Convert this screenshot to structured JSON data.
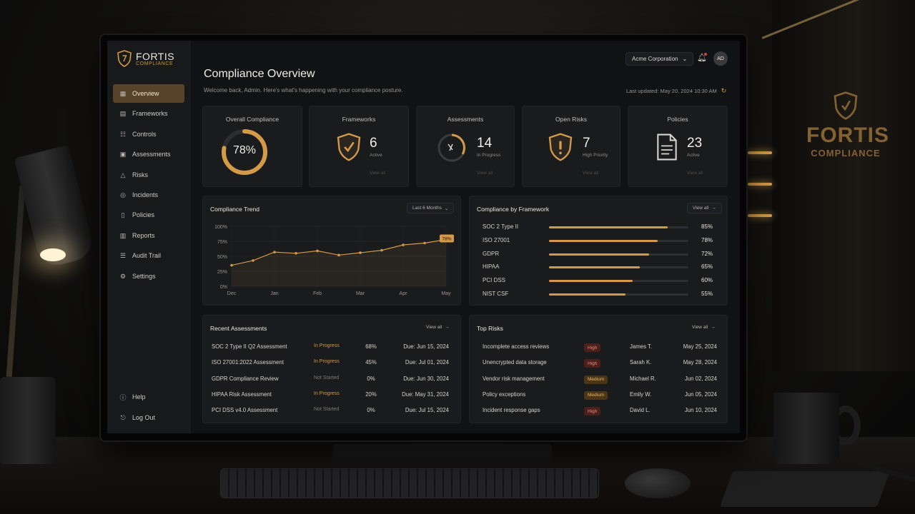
{
  "brand": {
    "name": "FORTIS",
    "tagline": "COMPLIANCE"
  },
  "wall_logo": {
    "name": "FORTIS",
    "tagline": "COMPLIANCE"
  },
  "sidebar": {
    "items": [
      {
        "label": "Overview",
        "icon": "grid-icon",
        "active": true
      },
      {
        "label": "Frameworks",
        "icon": "layers-icon"
      },
      {
        "label": "Controls",
        "icon": "sliders-icon"
      },
      {
        "label": "Assessments",
        "icon": "clipboard-icon"
      },
      {
        "label": "Risks",
        "icon": "warning-icon"
      },
      {
        "label": "Incidents",
        "icon": "alert-icon"
      },
      {
        "label": "Policies",
        "icon": "document-icon"
      },
      {
        "label": "Reports",
        "icon": "chart-icon"
      },
      {
        "label": "Audit Trail",
        "icon": "list-icon"
      },
      {
        "label": "Settings",
        "icon": "gear-icon"
      }
    ],
    "bottom": [
      {
        "label": "Help",
        "icon": "help-icon"
      },
      {
        "label": "Log Out",
        "icon": "logout-icon"
      }
    ]
  },
  "header": {
    "org": "Acme Corporation",
    "avatar": "AD",
    "title": "Compliance Overview",
    "subtitle": "Welcome back, Admin. Here's what's happening with your compliance posture.",
    "updated": "Last updated: May 20, 2024 10:30 AM"
  },
  "stats": [
    {
      "title": "Overall Compliance",
      "value": "78%",
      "progress": 0.78
    },
    {
      "title": "Frameworks",
      "value": "6",
      "sub": "Active",
      "link": "View all"
    },
    {
      "title": "Assessments",
      "value": "14",
      "sub": "In Progress",
      "link": "View all"
    },
    {
      "title": "Open Risks",
      "value": "7",
      "sub": "High Priority",
      "link": "View all"
    },
    {
      "title": "Policies",
      "value": "23",
      "sub": "Active",
      "link": "View all"
    }
  ],
  "trend": {
    "title": "Compliance Trend",
    "range": "Last 6 Months"
  },
  "chart_data": {
    "type": "line",
    "title": "Compliance Trend",
    "x": [
      "Dec",
      "",
      "Jan",
      "",
      "Feb",
      "",
      "Mar",
      "",
      "Apr",
      "",
      "May"
    ],
    "values": [
      35,
      43,
      57,
      55,
      59,
      52,
      56,
      60,
      69,
      72,
      78
    ],
    "ylim": [
      0,
      100
    ],
    "yticks": [
      "0%",
      "25%",
      "50%",
      "75%",
      "100%"
    ],
    "xticks": [
      "Dec",
      "Jan",
      "Feb",
      "Mar",
      "Apr",
      "May"
    ],
    "last_label": "78%",
    "accent": "#d39a48"
  },
  "frameworks": {
    "title": "Compliance by Framework",
    "link": "View all",
    "items": [
      {
        "name": "SOC 2 Type II",
        "pct": "85%",
        "value": 0.85
      },
      {
        "name": "ISO 27001",
        "pct": "78%",
        "value": 0.78
      },
      {
        "name": "GDPR",
        "pct": "72%",
        "value": 0.72
      },
      {
        "name": "HIPAA",
        "pct": "65%",
        "value": 0.65
      },
      {
        "name": "PCI DSS",
        "pct": "60%",
        "value": 0.6
      },
      {
        "name": "NIST CSF",
        "pct": "55%",
        "value": 0.55
      }
    ]
  },
  "assessments": {
    "title": "Recent Assessments",
    "link": "View all",
    "rows": [
      {
        "name": "SOC 2 Type II Q2 Assessment",
        "status": "In Progress",
        "pct": "68%",
        "due": "Due: Jun 15, 2024"
      },
      {
        "name": "ISO 27001:2022 Assessment",
        "status": "In Progress",
        "pct": "45%",
        "due": "Due: Jul 01, 2024"
      },
      {
        "name": "GDPR Compliance Review",
        "status": "Not Started",
        "pct": "0%",
        "due": "Due: Jun 30, 2024"
      },
      {
        "name": "HIPAA Risk Assessment",
        "status": "In Progress",
        "pct": "20%",
        "due": "Due: May 31, 2024"
      },
      {
        "name": "PCI DSS v4.0 Assessment",
        "status": "Not Started",
        "pct": "0%",
        "due": "Due: Jul 15, 2024"
      }
    ]
  },
  "risks": {
    "title": "Top Risks",
    "link": "View all",
    "rows": [
      {
        "name": "Incomplete access reviews",
        "severity": "High",
        "owner": "James T.",
        "date": "May 25, 2024"
      },
      {
        "name": "Unencrypted data storage",
        "severity": "High",
        "owner": "Sarah K.",
        "date": "May 28, 2024"
      },
      {
        "name": "Vendor risk management",
        "severity": "Medium",
        "owner": "Michael R.",
        "date": "Jun 02, 2024"
      },
      {
        "name": "Policy exceptions",
        "severity": "Medium",
        "owner": "Emily W.",
        "date": "Jun 05, 2024"
      },
      {
        "name": "Incident response gaps",
        "severity": "High",
        "owner": "David L.",
        "date": "Jun 10, 2024"
      }
    ]
  }
}
